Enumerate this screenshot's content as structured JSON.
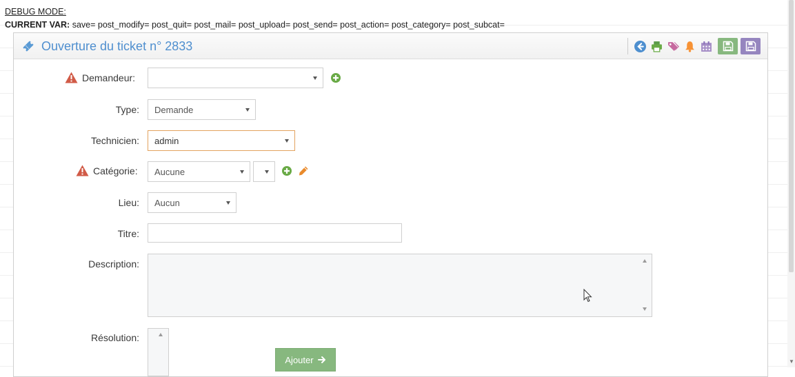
{
  "debug": {
    "title": "DEBUG MODE:",
    "var_label": "CURRENT VAR:",
    "var_values": "save= post_modify= post_quit= post_mail= post_upload= post_send= post_action= post_category= post_subcat="
  },
  "header": {
    "title": "Ouverture du ticket n° 2833",
    "icons": [
      "back-icon",
      "print-icon",
      "tags-icon",
      "bell-icon",
      "calendar-icon",
      "save-icon",
      "save-close-icon"
    ]
  },
  "form": {
    "demandeur": {
      "label": "Demandeur:",
      "value": ""
    },
    "type": {
      "label": "Type:",
      "value": "Demande"
    },
    "technicien": {
      "label": "Technicien:",
      "value": "admin"
    },
    "categorie": {
      "label": "Catégorie:",
      "value": "Aucune",
      "subcat": ""
    },
    "lieu": {
      "label": "Lieu:",
      "value": "Aucun"
    },
    "titre": {
      "label": "Titre:",
      "value": ""
    },
    "description": {
      "label": "Description:",
      "value": ""
    },
    "resolution": {
      "label": "Résolution:",
      "value": ""
    },
    "add_button": "Ajouter"
  },
  "colors": {
    "title_blue": "#4f8fcf",
    "warning_red": "#d15b47",
    "add_green": "#69aa46",
    "pencil_orange": "#e98a2b",
    "save_green": "#87b87f",
    "save_purple": "#9585bf",
    "active_border": "#e3a25e"
  }
}
